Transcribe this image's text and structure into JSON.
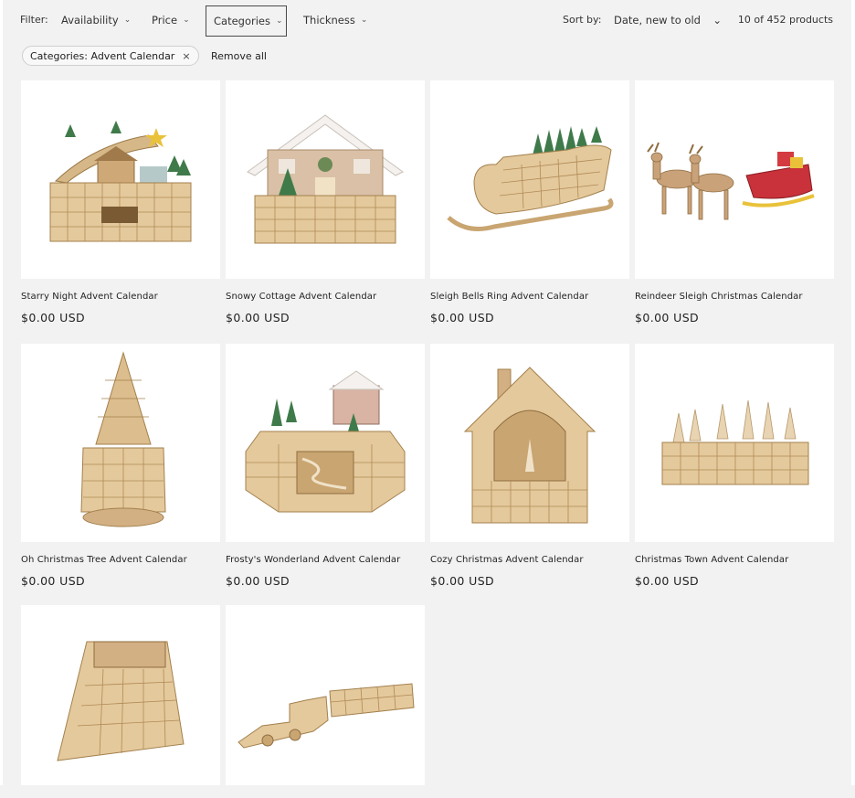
{
  "filters": {
    "label": "Filter:",
    "items": [
      {
        "label": "Availability",
        "active": false
      },
      {
        "label": "Price",
        "active": false
      },
      {
        "label": "Categories",
        "active": true
      },
      {
        "label": "Thickness",
        "active": false
      }
    ],
    "sort_label": "Sort by:",
    "sort_value": "Date, new to old",
    "count": "10 of 452 products"
  },
  "active_filter": {
    "label": "Categories: Advent Calendar",
    "close_icon": "×",
    "remove_all": "Remove all"
  },
  "products": [
    {
      "title": "Starry Night Advent Calendar",
      "price": "$0.00 USD",
      "image": "village-calendar"
    },
    {
      "title": "Snowy Cottage Advent Calendar",
      "price": "$0.00 USD",
      "image": "cottage-calendar"
    },
    {
      "title": "Sleigh Bells Ring Advent Calendar",
      "price": "$0.00 USD",
      "image": "sleigh-calendar"
    },
    {
      "title": "Reindeer Sleigh Christmas Calendar",
      "price": "$0.00 USD",
      "image": "reindeer-sleigh"
    },
    {
      "title": "Oh Christmas Tree Advent Calendar",
      "price": "$0.00 USD",
      "image": "tree-calendar"
    },
    {
      "title": "Frosty's Wonderland Advent Calendar",
      "price": "$0.00 USD",
      "image": "octagon-calendar"
    },
    {
      "title": "Cozy Christmas Advent Calendar",
      "price": "$0.00 USD",
      "image": "house-calendar"
    },
    {
      "title": "Christmas Town Advent Calendar",
      "price": "$0.00 USD",
      "image": "town-calendar"
    },
    {
      "title": "",
      "price": "",
      "image": "triangle-calendar"
    },
    {
      "title": "",
      "price": "",
      "image": "train-calendar"
    }
  ],
  "colors": {
    "wood": "#e2c699",
    "wood_dark": "#b08a55",
    "tree": "#3f7a4a",
    "red": "#c9323a",
    "gold": "#e9c23a"
  }
}
